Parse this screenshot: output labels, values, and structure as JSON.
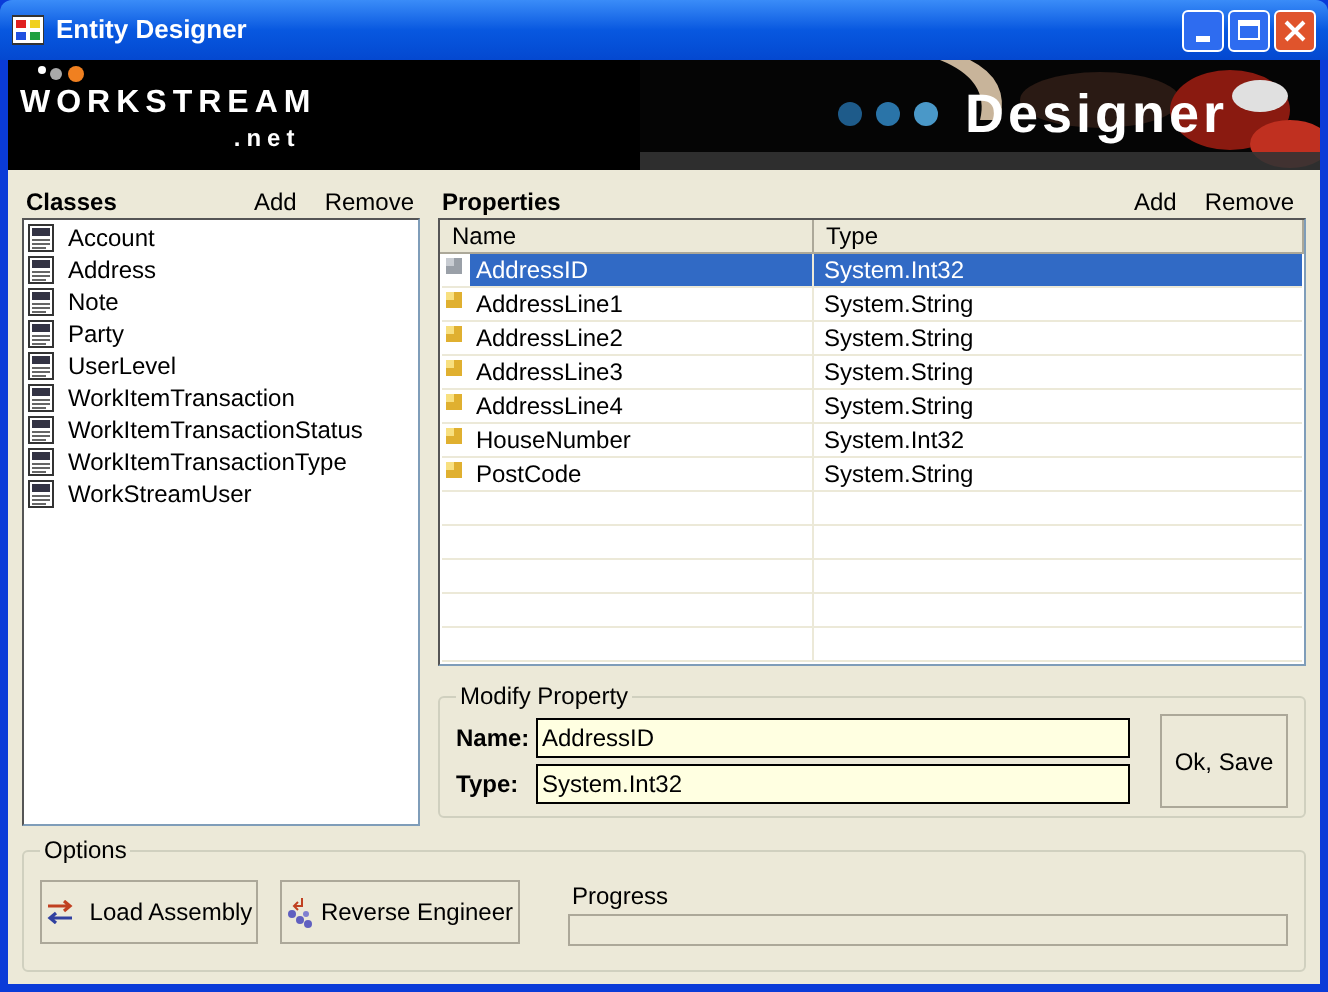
{
  "window": {
    "title": "Entity Designer"
  },
  "banner": {
    "brand": "WORKSTREAM",
    "brand_suffix": ".net",
    "product": "Designer"
  },
  "classes": {
    "title": "Classes",
    "add": "Add",
    "remove": "Remove",
    "items": [
      {
        "label": "Account",
        "selected": false
      },
      {
        "label": "Address",
        "selected": false
      },
      {
        "label": "Note",
        "selected": false
      },
      {
        "label": "Party",
        "selected": false
      },
      {
        "label": "UserLevel",
        "selected": false
      },
      {
        "label": "WorkItemTransaction",
        "selected": false
      },
      {
        "label": "WorkItemTransactionStatus",
        "selected": false
      },
      {
        "label": "WorkItemTransactionType",
        "selected": false
      },
      {
        "label": "WorkStreamUser",
        "selected": false
      }
    ]
  },
  "properties": {
    "title": "Properties",
    "add": "Add",
    "remove": "Remove",
    "columns": [
      "Name",
      "Type"
    ],
    "rows": [
      {
        "name": "AddressID",
        "type": "System.Int32",
        "selected": true
      },
      {
        "name": "AddressLine1",
        "type": "System.String",
        "selected": false
      },
      {
        "name": "AddressLine2",
        "type": "System.String",
        "selected": false
      },
      {
        "name": "AddressLine3",
        "type": "System.String",
        "selected": false
      },
      {
        "name": "AddressLine4",
        "type": "System.String",
        "selected": false
      },
      {
        "name": "HouseNumber",
        "type": "System.Int32",
        "selected": false
      },
      {
        "name": "PostCode",
        "type": "System.String",
        "selected": false
      }
    ]
  },
  "modify_property": {
    "title": "Modify Property",
    "name_label": "Name:",
    "name_value": "AddressID",
    "type_label": "Type:",
    "type_value": "System.Int32",
    "save": "Ok, Save"
  },
  "options": {
    "title": "Options",
    "load_assembly": "Load Assembly",
    "reverse_engineer": "Reverse Engineer",
    "progress_label": "Progress",
    "progress": {
      "level": 0
    }
  }
}
